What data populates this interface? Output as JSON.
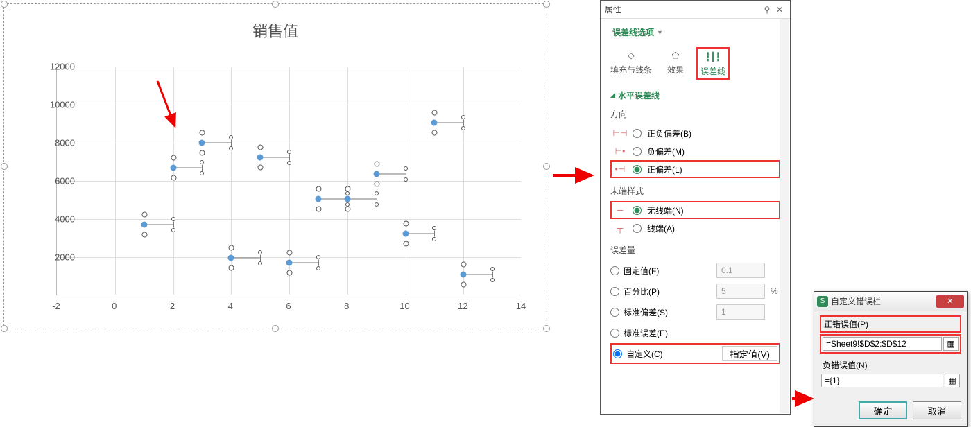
{
  "chart_data": {
    "type": "scatter",
    "title": "销售值",
    "xlabel": "",
    "ylabel": "",
    "xlim": [
      -2,
      14
    ],
    "ylim": [
      0,
      12000
    ],
    "x_ticks": [
      -2,
      0,
      2,
      4,
      6,
      8,
      10,
      12,
      14
    ],
    "y_ticks": [
      2000,
      4000,
      6000,
      8000,
      10000,
      12000
    ],
    "series": [
      {
        "name": "销售值",
        "points": [
          {
            "x": 1,
            "y": 3700,
            "err_x": 1
          },
          {
            "x": 2,
            "y": 6700,
            "err_x": 1
          },
          {
            "x": 3,
            "y": 8000,
            "err_x": 1
          },
          {
            "x": 4,
            "y": 1950,
            "err_x": 1
          },
          {
            "x": 5,
            "y": 7250,
            "err_x": 1
          },
          {
            "x": 6,
            "y": 1700,
            "err_x": 1
          },
          {
            "x": 7,
            "y": 5050,
            "err_x": 1
          },
          {
            "x": 8,
            "y": 5050,
            "err_x": 1
          },
          {
            "x": 9,
            "y": 6350,
            "err_x": 1
          },
          {
            "x": 10,
            "y": 3250,
            "err_x": 1
          },
          {
            "x": 11,
            "y": 9050,
            "err_x": 1
          },
          {
            "x": 12,
            "y": 1100,
            "err_x": 1
          }
        ]
      }
    ]
  },
  "panel": {
    "title": "属性",
    "dropdown": "误差线选项",
    "tabs": {
      "fill": "填充与线条",
      "effect": "效果",
      "errorbar": "误差线"
    },
    "section_title": "水平误差线",
    "direction": {
      "heading": "方向",
      "both": "正负偏差(B)",
      "minus": "负偏差(M)",
      "plus": "正偏差(L)"
    },
    "endstyle": {
      "heading": "末端样式",
      "nocap": "无线端(N)",
      "cap": "线端(A)"
    },
    "amount": {
      "heading": "误差量",
      "fixed": "固定值(F)",
      "fixed_val": "0.1",
      "percent": "百分比(P)",
      "percent_val": "5",
      "percent_unit": "%",
      "stddev": "标准偏差(S)",
      "stddev_val": "1",
      "stderr": "标准误差(E)",
      "custom": "自定义(C)",
      "custom_btn": "指定值(V)"
    }
  },
  "dialog": {
    "title": "自定义错误栏",
    "pos_label": "正错误值(P)",
    "pos_value": "=Sheet9!$D$2:$D$12",
    "neg_label": "负错误值(N)",
    "neg_value": "={1}",
    "ok": "确定",
    "cancel": "取消"
  }
}
